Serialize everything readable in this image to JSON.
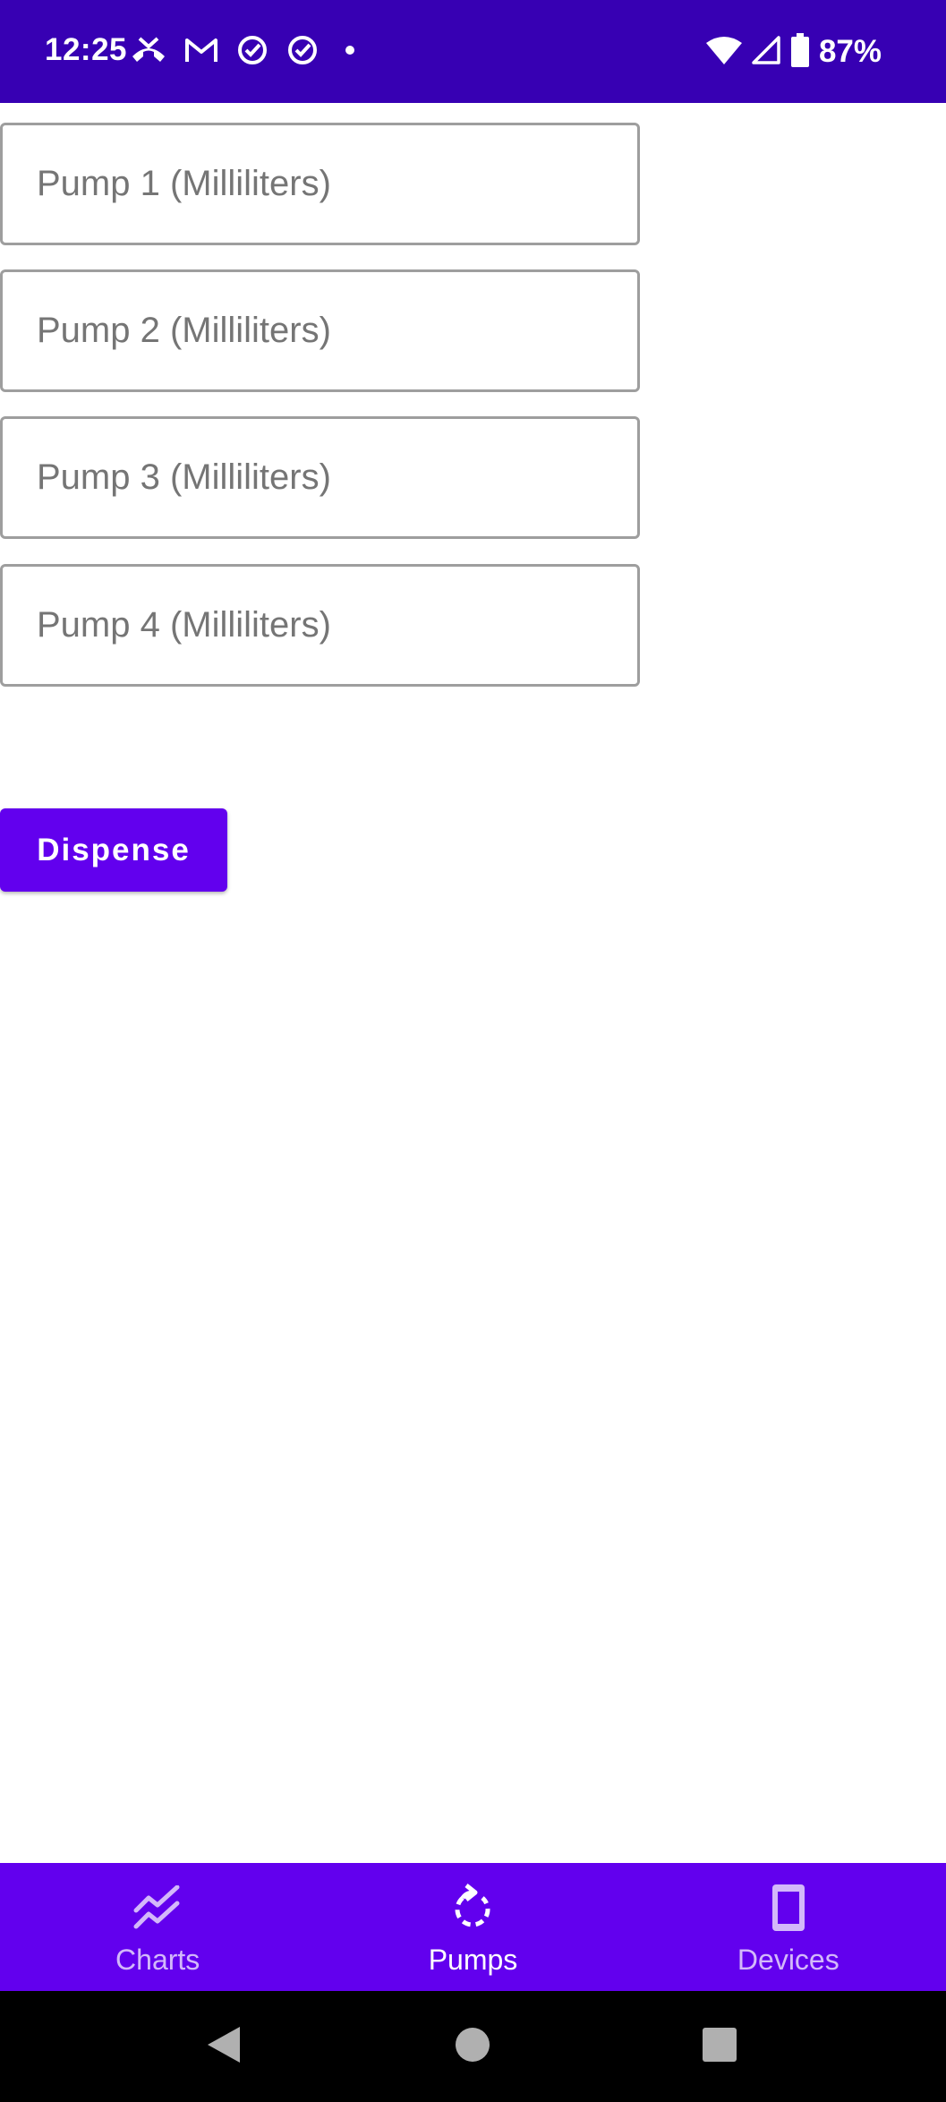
{
  "status_bar": {
    "time": "12:25",
    "battery": "87%",
    "background": "#3700b3",
    "icons_left": [
      "missed-call-icon",
      "gmail-icon",
      "check-circle-icon",
      "check-circle-icon",
      "dot-icon"
    ],
    "icons_right": [
      "wifi-icon",
      "cell-signal-icon",
      "battery-icon"
    ]
  },
  "form": {
    "fields": [
      {
        "value": "",
        "placeholder": "Pump 1 (Milliliters)"
      },
      {
        "value": "",
        "placeholder": "Pump 2 (Milliliters)"
      },
      {
        "value": "",
        "placeholder": "Pump 3 (Milliliters)"
      },
      {
        "value": "",
        "placeholder": "Pump 4 (Milliliters)"
      }
    ],
    "dispense_label": "Dispense"
  },
  "bottom_nav": {
    "background": "#6200ee",
    "items": [
      {
        "label": "Charts",
        "icon": "chart-icon",
        "active": false
      },
      {
        "label": "Pumps",
        "icon": "pump-icon",
        "active": true
      },
      {
        "label": "Devices",
        "icon": "device-icon",
        "active": false
      }
    ]
  },
  "system_nav": {
    "buttons": [
      "back-icon",
      "home-icon",
      "recents-icon"
    ]
  }
}
